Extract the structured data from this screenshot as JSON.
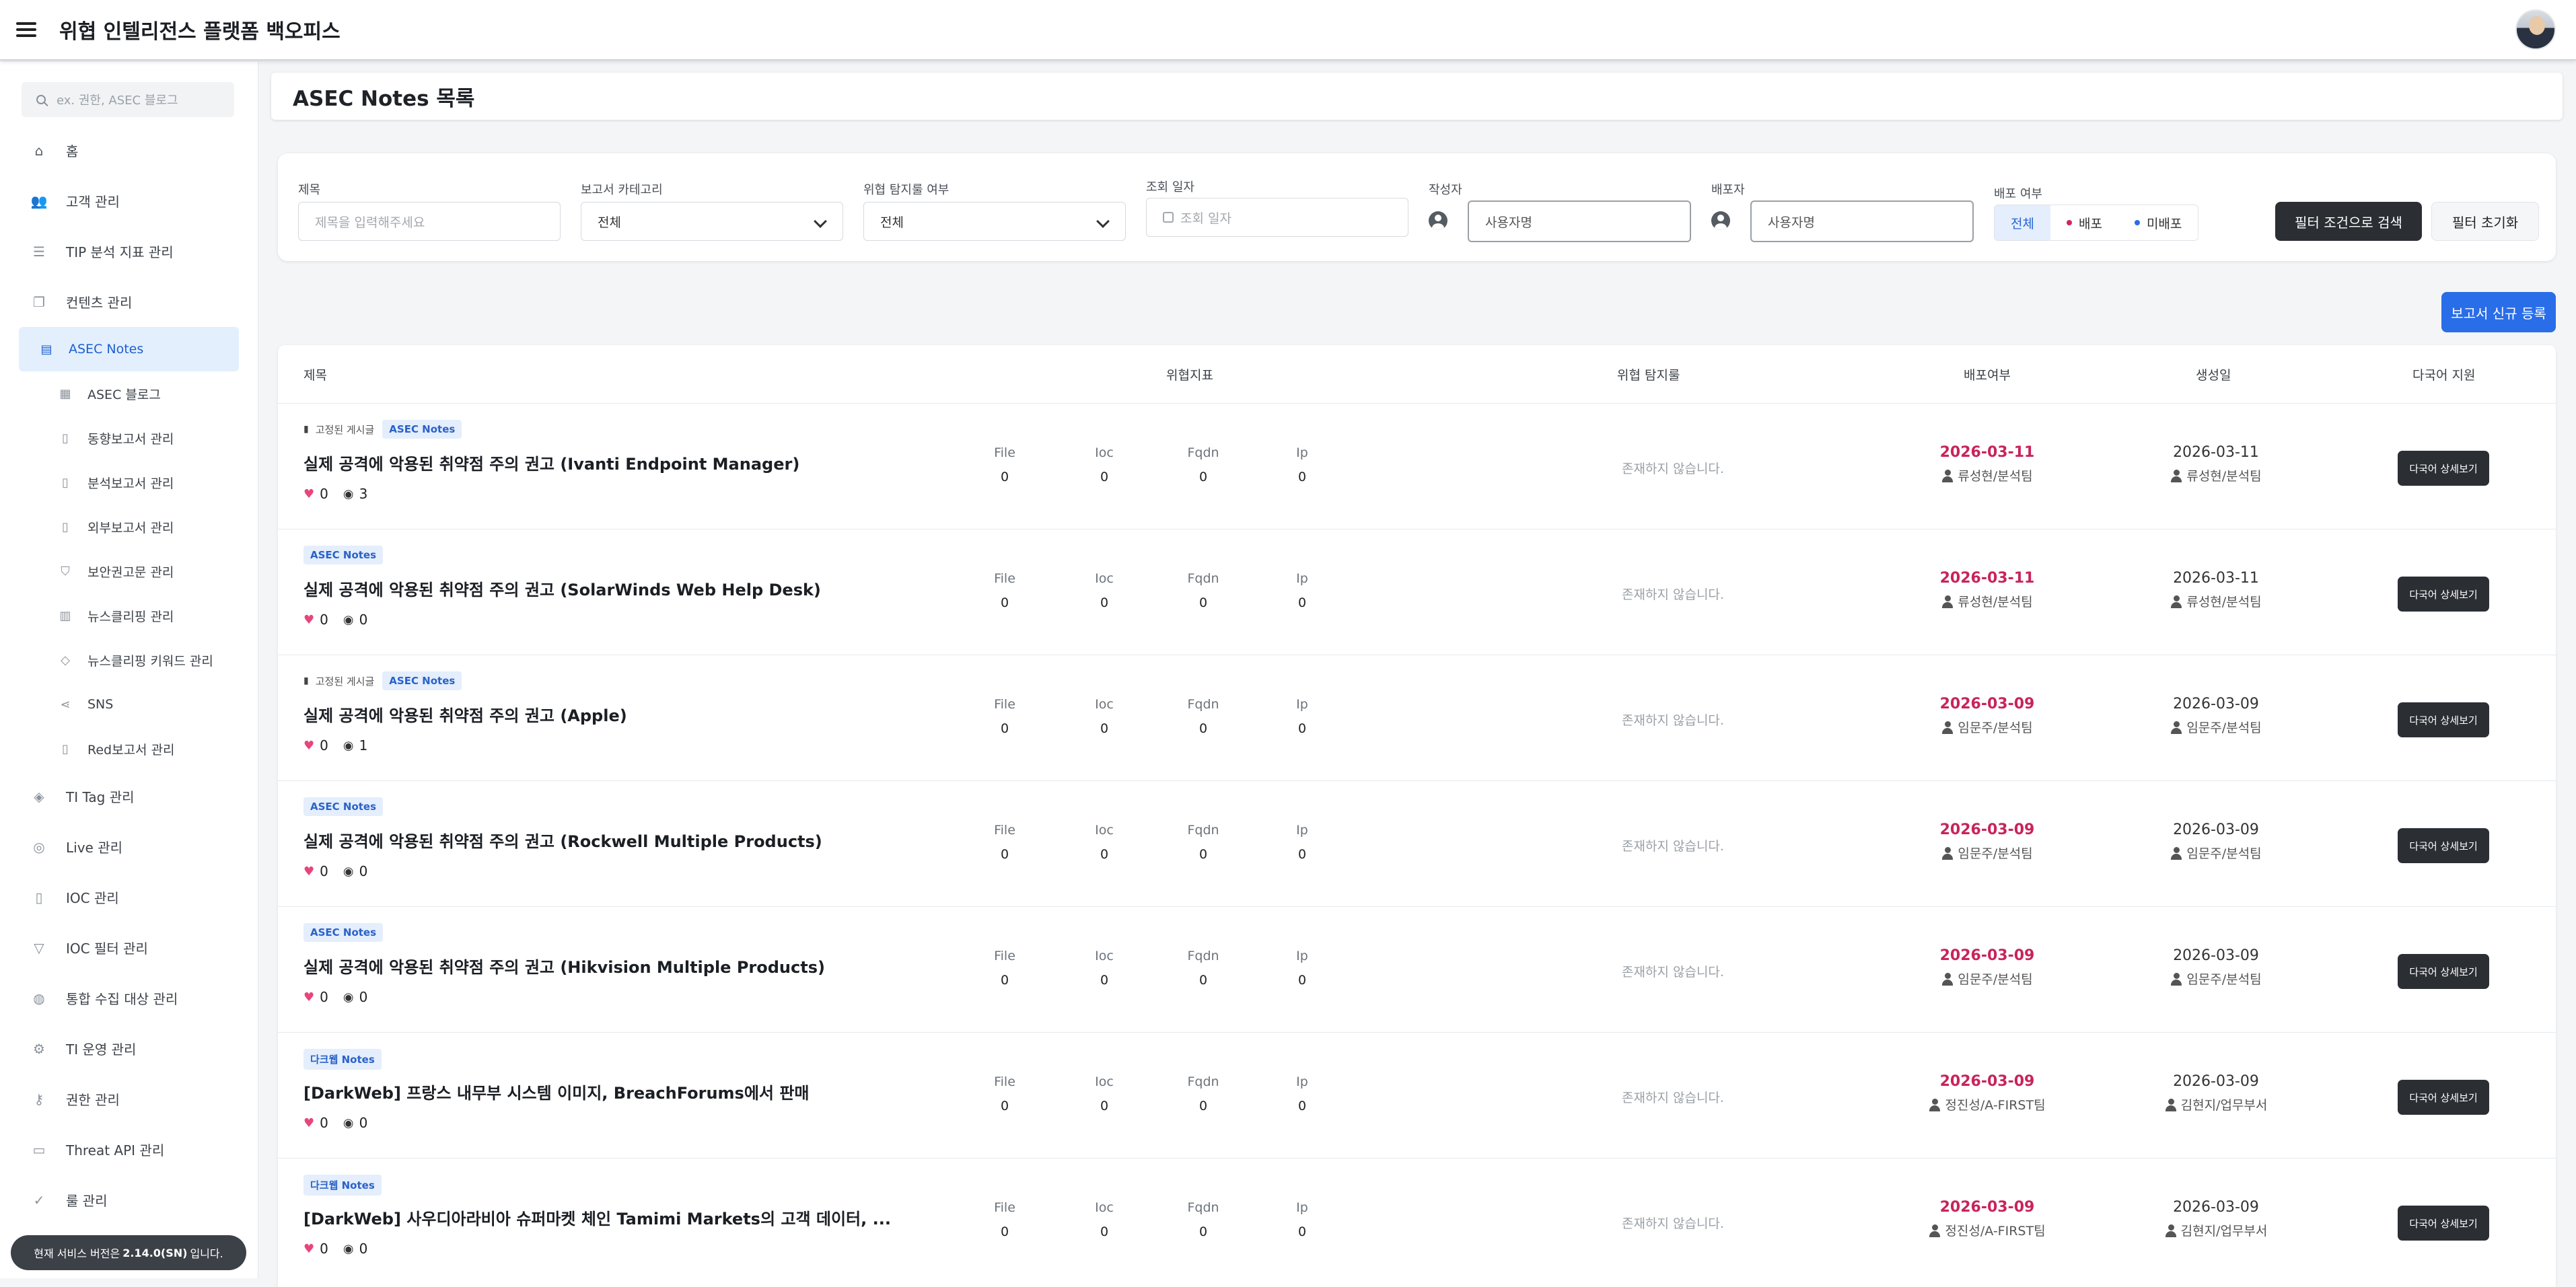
{
  "app": {
    "title": "위협 인텔리전스 플랫폼 백오피스"
  },
  "sidebar": {
    "search_placeholder": "ex. 권한, ASEC 블로그",
    "items": [
      {
        "label": "홈",
        "icon": "home-icon"
      },
      {
        "label": "고객 관리",
        "icon": "users-icon"
      },
      {
        "label": "TIP 분석 지표 관리",
        "icon": "database-icon"
      },
      {
        "label": "컨텐츠 관리",
        "icon": "copy-icon"
      }
    ],
    "sub_items": [
      {
        "label": "ASEC Notes",
        "icon": "note-icon",
        "active": true
      },
      {
        "label": "ASEC 블로그",
        "icon": "blog-icon"
      },
      {
        "label": "동향보고서 관리",
        "icon": "document-icon"
      },
      {
        "label": "분석보고서 관리",
        "icon": "document-search-icon"
      },
      {
        "label": "외부보고서 관리",
        "icon": "document-icon"
      },
      {
        "label": "보안권고문 관리",
        "icon": "shield-icon"
      },
      {
        "label": "뉴스클리핑 관리",
        "icon": "newspaper-icon"
      },
      {
        "label": "뉴스클리핑 키워드 관리",
        "icon": "tag-edit-icon"
      },
      {
        "label": "SNS",
        "icon": "share-icon"
      },
      {
        "label": "Red보고서 관리",
        "icon": "document-icon"
      }
    ],
    "items_after": [
      {
        "label": "TI Tag 관리",
        "icon": "tags-icon"
      },
      {
        "label": "Live 관리",
        "icon": "broadcast-icon"
      },
      {
        "label": "IOC 관리",
        "icon": "file-icon"
      },
      {
        "label": "IOC 필터 관리",
        "icon": "filter-icon"
      },
      {
        "label": "통합 수집 대상 관리",
        "icon": "globe-icon"
      },
      {
        "label": "TI 운영 관리",
        "icon": "user-gear-icon"
      },
      {
        "label": "권한 관리",
        "icon": "user-key-icon"
      },
      {
        "label": "Threat API 관리",
        "icon": "api-icon"
      },
      {
        "label": "룰 관리",
        "icon": "badge-check-icon"
      }
    ],
    "version_prefix": "현재 서비스 버전은",
    "version": "2.14.0(SN)",
    "version_suffix": "입니다."
  },
  "page": {
    "title": "ASEC Notes 목록"
  },
  "filters": {
    "title_label": "제목",
    "title_placeholder": "제목을 입력해주세요",
    "category_label": "보고서 카테고리",
    "category_value": "전체",
    "detect_label": "위협 탐지룰 여부",
    "detect_value": "전체",
    "date_label": "조회 일자",
    "date_placeholder": "조회 일자",
    "author_label": "작성자",
    "author_placeholder": "사용자명",
    "deployer_label": "배포자",
    "deployer_placeholder": "사용자명",
    "deploy_label": "배포 여부",
    "deploy_options": [
      "전체",
      "배포",
      "미배포"
    ],
    "search_button": "필터 조건으로 검색",
    "reset_button": "필터 초기화"
  },
  "new_report_button": "보고서 신규 등록",
  "table": {
    "headers": {
      "title": "제목",
      "indicators": "위협지표",
      "rules": "위협 탐지룰",
      "deploy": "배포여부",
      "created": "생성일",
      "multilang": "다국어 지원"
    },
    "ioc_labels": [
      "File",
      "Ioc",
      "Fqdn",
      "Ip"
    ],
    "pinned_label": "고정된 게시글",
    "none_text": "존재하지 않습니다.",
    "detail_button": "다국어 상세보기",
    "rows": [
      {
        "pinned": true,
        "badge": "ASEC Notes",
        "title": "실제 공격에 악용된 취약점 주의 권고 (Ivanti Endpoint Manager)",
        "likes": "0",
        "views": "3",
        "ioc": [
          "0",
          "0",
          "0",
          "0"
        ],
        "deploy_date": "2026-03-11",
        "deployer": "류성현/분석팀",
        "created_date": "2026-03-11",
        "creator": "류성현/분석팀"
      },
      {
        "pinned": false,
        "badge": "ASEC Notes",
        "title": "실제 공격에 악용된 취약점 주의 권고 (SolarWinds Web Help Desk)",
        "likes": "0",
        "views": "0",
        "ioc": [
          "0",
          "0",
          "0",
          "0"
        ],
        "deploy_date": "2026-03-11",
        "deployer": "류성현/분석팀",
        "created_date": "2026-03-11",
        "creator": "류성현/분석팀"
      },
      {
        "pinned": true,
        "badge": "ASEC Notes",
        "title": "실제 공격에 악용된 취약점 주의 권고 (Apple)",
        "likes": "0",
        "views": "1",
        "ioc": [
          "0",
          "0",
          "0",
          "0"
        ],
        "deploy_date": "2026-03-09",
        "deployer": "임문주/분석팀",
        "created_date": "2026-03-09",
        "creator": "임문주/분석팀"
      },
      {
        "pinned": false,
        "badge": "ASEC Notes",
        "title": "실제 공격에 악용된 취약점 주의 권고 (Rockwell Multiple Products)",
        "likes": "0",
        "views": "0",
        "ioc": [
          "0",
          "0",
          "0",
          "0"
        ],
        "deploy_date": "2026-03-09",
        "deployer": "임문주/분석팀",
        "created_date": "2026-03-09",
        "creator": "임문주/분석팀"
      },
      {
        "pinned": false,
        "badge": "ASEC Notes",
        "title": "실제 공격에 악용된 취약점 주의 권고 (Hikvision Multiple Products)",
        "likes": "0",
        "views": "0",
        "ioc": [
          "0",
          "0",
          "0",
          "0"
        ],
        "deploy_date": "2026-03-09",
        "deployer": "임문주/분석팀",
        "created_date": "2026-03-09",
        "creator": "임문주/분석팀"
      },
      {
        "pinned": false,
        "badge": "다크웹 Notes",
        "title": "[DarkWeb] 프랑스 내무부 시스템 이미지, BreachForums에서 판매",
        "likes": "0",
        "views": "0",
        "ioc": [
          "0",
          "0",
          "0",
          "0"
        ],
        "deploy_date": "2026-03-09",
        "deployer": "정진성/A-FIRST팀",
        "created_date": "2026-03-09",
        "creator": "김현지/업무부서"
      },
      {
        "pinned": false,
        "badge": "다크웹 Notes",
        "title": "[DarkWeb] 사우디아라비아 슈퍼마켓 체인 Tamimi Markets의 고객 데이터, ...",
        "likes": "0",
        "views": "0",
        "ioc": [
          "0",
          "0",
          "0",
          "0"
        ],
        "deploy_date": "2026-03-09",
        "deployer": "정진성/A-FIRST팀",
        "created_date": "2026-03-09",
        "creator": "김현지/업무부서"
      }
    ]
  },
  "colors": {
    "accent": "#2a6de8",
    "deploy_date": "#c8245b",
    "active_nav_bg": "#e3effd",
    "dark_button": "#2b2e33"
  }
}
